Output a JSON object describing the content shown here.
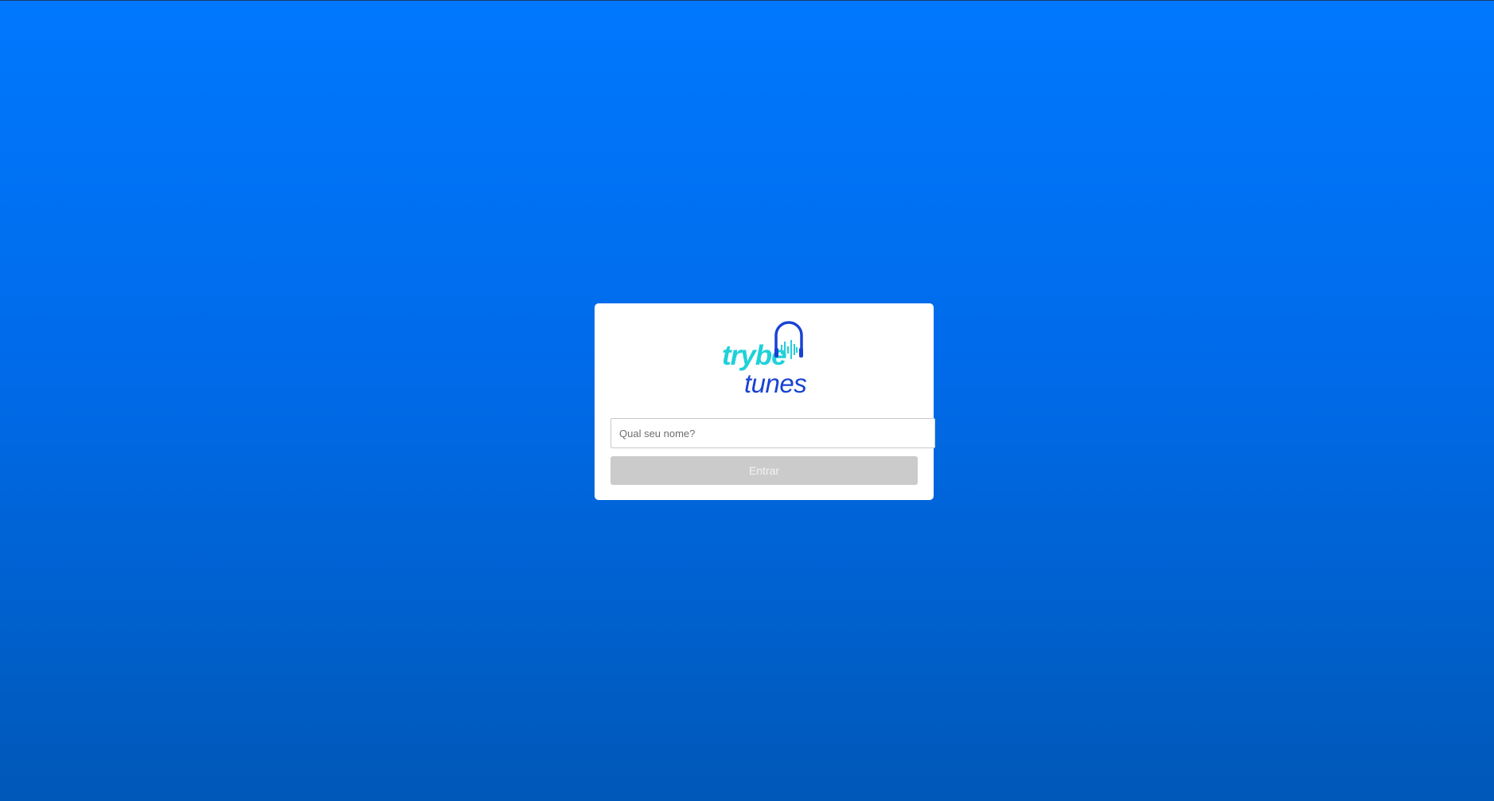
{
  "brand": {
    "word_1": "trybe",
    "word_2": "tunes",
    "icon": "headphones-soundwave-icon",
    "colors": {
      "primary_text": "#1fd1d9",
      "secondary_text": "#1942d4"
    }
  },
  "login": {
    "name_placeholder": "Qual seu nome?",
    "name_value": "",
    "submit_label": "Entrar",
    "submit_enabled": false
  },
  "colors": {
    "background_top": "#0078fe",
    "background_bottom": "#0058b8",
    "card": "#ffffff",
    "button_disabled": "#cbcbcb"
  }
}
